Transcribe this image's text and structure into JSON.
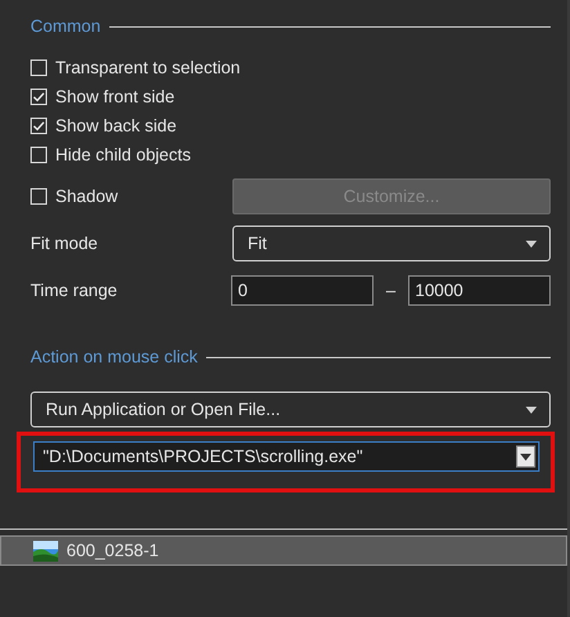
{
  "common": {
    "heading": "Common",
    "checkboxes": [
      {
        "label": "Transparent to selection",
        "checked": false
      },
      {
        "label": "Show front side",
        "checked": true
      },
      {
        "label": "Show back side",
        "checked": true
      },
      {
        "label": "Hide child objects",
        "checked": false
      }
    ],
    "shadow": {
      "label": "Shadow",
      "checked": false
    },
    "customize_button": {
      "label": "Customize...",
      "disabled": true
    },
    "fit_mode": {
      "label": "Fit mode",
      "value": "Fit"
    },
    "time_range": {
      "label": "Time range",
      "from": "0",
      "separator": "–",
      "to": "10000"
    }
  },
  "action": {
    "heading": "Action on mouse click",
    "type_value": "Run Application or Open File...",
    "path_value": "\"D:\\Documents\\PROJECTS\\scrolling.exe\"",
    "highlighted": true
  },
  "list": [
    {
      "label": "600_0258-1",
      "selected": true
    }
  ]
}
